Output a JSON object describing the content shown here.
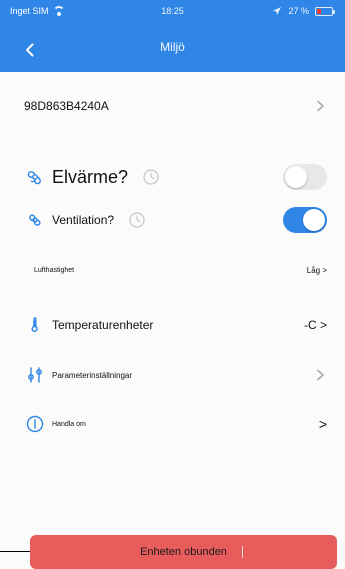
{
  "status_bar": {
    "carrier": "Inget SIM",
    "time": "18:25",
    "battery_percent": "27 %",
    "colors": {
      "low_battery": "#ff3b30"
    }
  },
  "header": {
    "title": "Miljö",
    "back_icon": "chevron-left-icon",
    "color": "#2f86e6"
  },
  "device": {
    "id": "98D863B4240A"
  },
  "settings": {
    "elvarme": {
      "label": "Elvärme?",
      "enabled": false,
      "icon": "fan-icon"
    },
    "ventilation": {
      "label": "Ventilation?",
      "enabled": true,
      "icon": "fan-icon"
    },
    "lufthastighet": {
      "label": "Lufthastighet",
      "value": "Låg >"
    },
    "temperature_units": {
      "label": "Temperaturenheter",
      "value": "-C >",
      "icon": "thermometer-icon"
    },
    "parameters": {
      "label": "Parameterinställningar",
      "icon": "sliders-icon"
    },
    "about": {
      "label": "Handla om",
      "icon": "info-icon",
      "chevron": ">"
    }
  },
  "footer": {
    "button_label": "Enheten obunden",
    "button_color": "#e85c5c"
  }
}
